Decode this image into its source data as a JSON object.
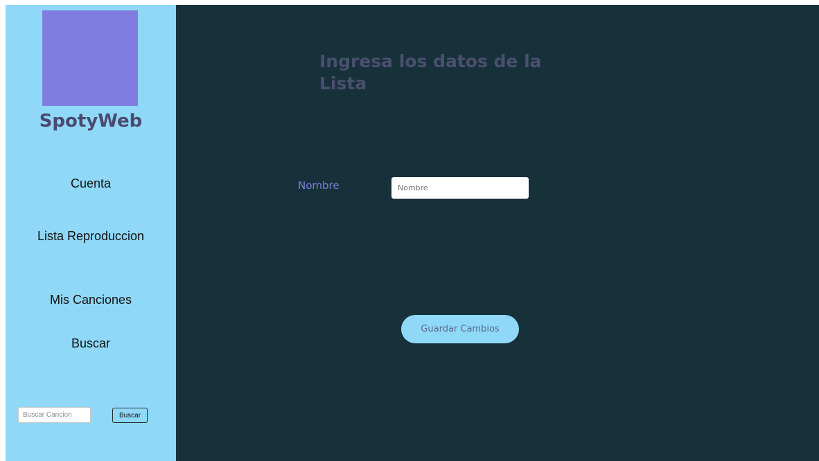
{
  "colors": {
    "sidebar_bg": "#8fd8f7",
    "main_bg": "#16313a",
    "logo_placeholder": "#7f7ee0",
    "title_text": "#4b4e6e",
    "label_text": "#7f7ee0",
    "button_bg": "#8fd8f7"
  },
  "sidebar": {
    "brand": "SpotyWeb",
    "items": [
      {
        "label": "Cuenta"
      },
      {
        "label": "Lista Reproduccion"
      },
      {
        "label": "Mis Canciones"
      },
      {
        "label": "Buscar"
      }
    ],
    "search": {
      "placeholder": "Buscar Cancion",
      "value": "",
      "button_label": "Buscar"
    }
  },
  "main": {
    "title": "Ingresa los datos de la Lista",
    "form": {
      "name_label": "Nombre",
      "name_placeholder": "Nombre",
      "name_value": "",
      "submit_label": "Guardar Cambios"
    }
  }
}
